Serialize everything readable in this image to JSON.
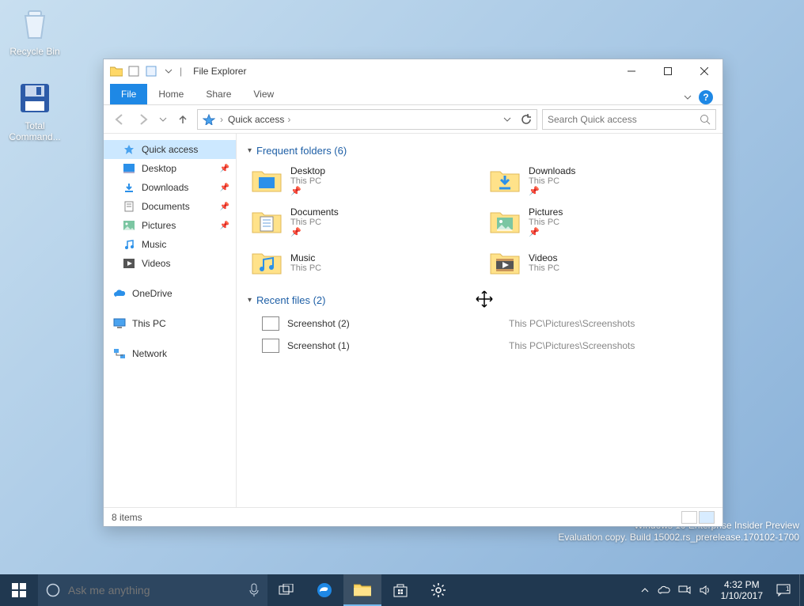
{
  "desktop_icons": [
    {
      "name": "Recycle Bin"
    },
    {
      "name": "Total Command..."
    }
  ],
  "watermark": {
    "line1": "Windows 10 Enterprise Insider Preview",
    "line2": "Evaluation copy. Build 15002.rs_prerelease.170102-1700"
  },
  "taskbar": {
    "search_placeholder": "Ask me anything",
    "time": "4:32 PM",
    "date": "1/10/2017"
  },
  "window": {
    "title": "File Explorer",
    "tabs": {
      "file": "File",
      "home": "Home",
      "share": "Share",
      "view": "View"
    },
    "address": {
      "location": "Quick access"
    },
    "search_placeholder": "Search Quick access",
    "sidebar": {
      "quick_access": "Quick access",
      "desktop": "Desktop",
      "downloads": "Downloads",
      "documents": "Documents",
      "pictures": "Pictures",
      "music": "Music",
      "videos": "Videos",
      "onedrive": "OneDrive",
      "this_pc": "This PC",
      "network": "Network"
    },
    "groups": {
      "frequent": {
        "header": "Frequent folders (6)"
      },
      "recent": {
        "header": "Recent files (2)"
      }
    },
    "folders": [
      {
        "name": "Desktop",
        "sub": "This PC"
      },
      {
        "name": "Downloads",
        "sub": "This PC"
      },
      {
        "name": "Documents",
        "sub": "This PC"
      },
      {
        "name": "Pictures",
        "sub": "This PC"
      },
      {
        "name": "Music",
        "sub": "This PC"
      },
      {
        "name": "Videos",
        "sub": "This PC"
      }
    ],
    "recent": [
      {
        "name": "Screenshot (2)",
        "path": "This PC\\Pictures\\Screenshots"
      },
      {
        "name": "Screenshot (1)",
        "path": "This PC\\Pictures\\Screenshots"
      }
    ],
    "status": "8 items"
  }
}
